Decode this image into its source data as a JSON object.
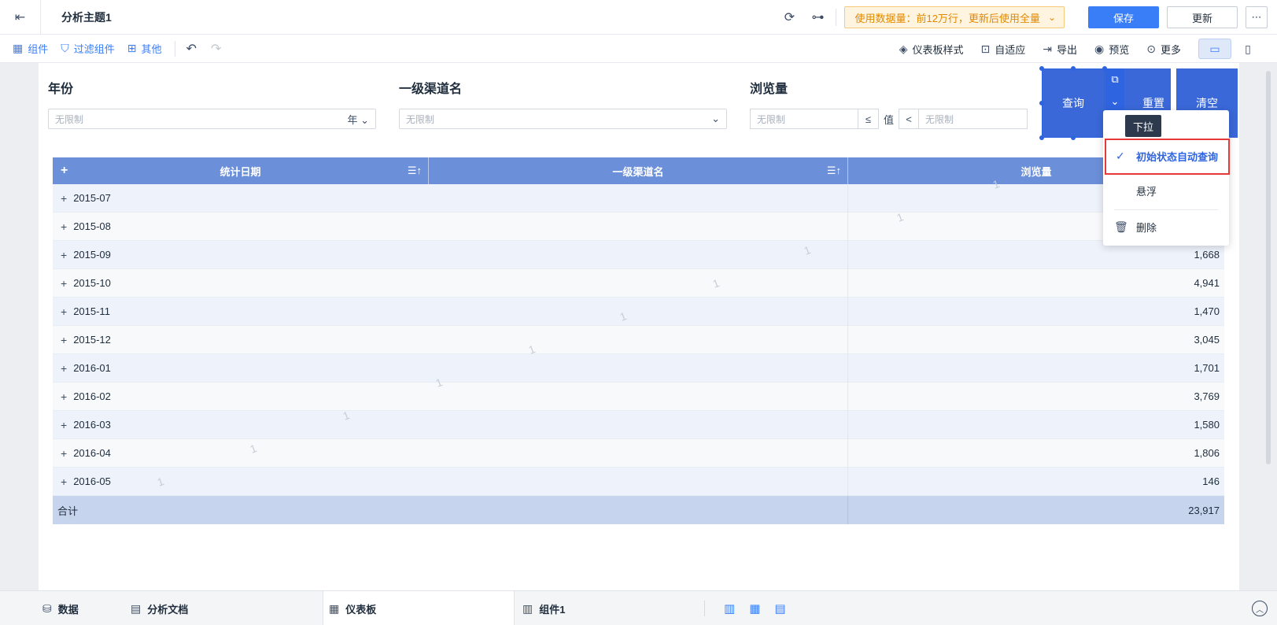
{
  "topbar": {
    "title": "分析主题1",
    "warning": "使用数据量：前12万行，更新后使用全量",
    "save_label": "保存",
    "update_label": "更新"
  },
  "toolbar": {
    "component": "组件",
    "filter_component": "过滤组件",
    "other": "其他",
    "dashboard_style": "仪表板样式",
    "adaptive": "自适应",
    "export": "导出",
    "preview": "预览",
    "more": "更多"
  },
  "filters": {
    "year": {
      "title": "年份",
      "placeholder": "无限制",
      "suffix": "年"
    },
    "channel": {
      "title": "一级渠道名",
      "placeholder": "无限制"
    },
    "pv": {
      "title": "浏览量",
      "min_placeholder": "无限制",
      "op1": "≤",
      "value_label": "值",
      "op2": "<",
      "max_placeholder": "无限制"
    }
  },
  "buttons": {
    "query": "查询",
    "reset": "重置",
    "clear": "清空"
  },
  "table": {
    "columns": [
      "统计日期",
      "一级渠道名",
      "浏览量"
    ],
    "rows": [
      {
        "date": "2015-07",
        "pv": ""
      },
      {
        "date": "2015-08",
        "pv": ""
      },
      {
        "date": "2015-09",
        "pv": "1,668"
      },
      {
        "date": "2015-10",
        "pv": "4,941"
      },
      {
        "date": "2015-11",
        "pv": "1,470"
      },
      {
        "date": "2015-12",
        "pv": "3,045"
      },
      {
        "date": "2016-01",
        "pv": "1,701"
      },
      {
        "date": "2016-02",
        "pv": "3,769"
      },
      {
        "date": "2016-03",
        "pv": "1,580"
      },
      {
        "date": "2016-04",
        "pv": "1,806"
      },
      {
        "date": "2016-05",
        "pv": "146"
      }
    ],
    "total_label": "合计",
    "total_value": "23,917"
  },
  "menu": {
    "tooltip": "下拉",
    "auto_query": "初始状态自动查询",
    "float": "悬浮",
    "delete": "删除"
  },
  "bottom": {
    "data": "数据",
    "doc": "分析文档",
    "dashboard": "仪表板",
    "widget": "组件1"
  },
  "watermark": "1"
}
